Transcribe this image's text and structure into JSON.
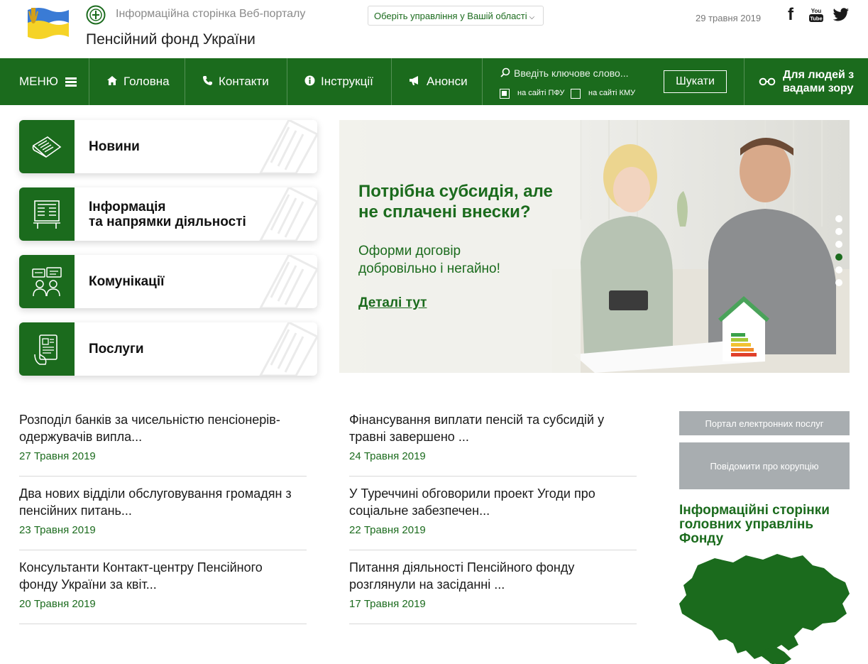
{
  "header": {
    "portal_caption": "Інформаційна сторінка Веб-порталу",
    "site_title": "Пенсійний фонд України",
    "region_select": "Оберіть управління у Вашій області",
    "date": "29 травня 2019",
    "social": {
      "youtube_label": "You Tube"
    }
  },
  "nav": {
    "menu": "МЕНЮ",
    "home": "Головна",
    "contacts": "Контакти",
    "instructions": "Інструкції",
    "announcements": "Анонси",
    "search_placeholder": "Введіть ключове слово...",
    "option_pfu": "на сайті ПФУ",
    "option_kmu": "на сайті КМУ",
    "search_button": "Шукати",
    "accessibility_line1": "Для людей з",
    "accessibility_line2": "вадами зору"
  },
  "categories": [
    {
      "label": "Новини",
      "icon": "newspaper-icon"
    },
    {
      "label_line1": "Інформація",
      "label_line2": "та напрямки діяльності",
      "icon": "documents-icon"
    },
    {
      "label": "Комунікації",
      "icon": "chat-people-icon"
    },
    {
      "label": "Послуги",
      "icon": "tablet-hand-icon"
    }
  ],
  "banner": {
    "headline_line1": "Потрібна субсидія, але",
    "headline_line2": "не сплачені внески?",
    "text_line1": "Оформи договір",
    "text_line2": "добровільно і негайно!",
    "link": "Деталі тут",
    "slides_count": 6,
    "active_slide": 4
  },
  "news_left": [
    {
      "title_line1": "Розподіл банків за чисельністю пенсіонерів-",
      "title_line2": "одержувачів випла...",
      "date": "27 Травня 2019"
    },
    {
      "title_line1": "Два нових відділи обслуговування громадян з",
      "title_line2": "пенсійних питань...",
      "date": "23 Травня 2019"
    },
    {
      "title_line1": "Консультанти Контакт-центру Пенсійного",
      "title_line2": "фонду України за квіт...",
      "date": "20 Травня 2019"
    }
  ],
  "news_right": [
    {
      "title_line1": "Фінансування виплати пенсій та субсидій у",
      "title_line2": "травні завершено ...",
      "date": "24 Травня 2019"
    },
    {
      "title_line1": "У Туреччині обговорили проект Угоди про",
      "title_line2": "соціальне забезпечен...",
      "date": "22 Травня 2019"
    },
    {
      "title_line1": "Питання діяльності Пенсійного фонду",
      "title_line2": "розглянули на засіданні ...",
      "date": "17 Травня 2019"
    }
  ],
  "sidebar": {
    "btn_portal": "Портал електронних послуг",
    "btn_corruption": "Повідомити про корупцію",
    "heading_line1": "Інформаційні сторінки",
    "heading_line2": "головних управлінь",
    "heading_line3": "Фонду"
  },
  "colors": {
    "brand_green": "#1b6b1d",
    "side_button_gray": "#a8adb0"
  }
}
